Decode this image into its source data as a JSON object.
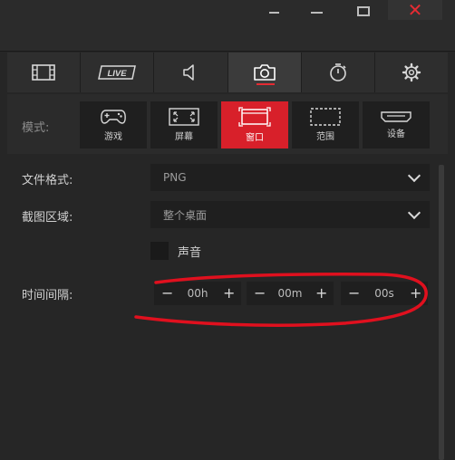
{
  "window_controls": {
    "close_glyph": "✕",
    "accent": "#e52b33"
  },
  "tabs": [
    {
      "icon": "film-icon",
      "active": false
    },
    {
      "icon": "live-icon",
      "label": "LIVE",
      "active": false
    },
    {
      "icon": "audio-icon",
      "active": false
    },
    {
      "icon": "camera-icon",
      "active": true
    },
    {
      "icon": "timer-icon",
      "active": false
    },
    {
      "icon": "gear-icon",
      "active": false
    }
  ],
  "mode": {
    "label": "模式:",
    "options": [
      {
        "icon": "gamepad-icon",
        "label": "游戏",
        "active": false
      },
      {
        "icon": "fullscreen-icon",
        "label": "屏幕",
        "active": false
      },
      {
        "icon": "window-icon",
        "label": "窗口",
        "active": true
      },
      {
        "icon": "region-icon",
        "label": "范围",
        "active": false
      },
      {
        "icon": "hdmi-icon",
        "label": "设备",
        "active": false
      }
    ]
  },
  "settings": {
    "file_format": {
      "label": "文件格式:",
      "value": "PNG"
    },
    "capture_area": {
      "label": "截图区域:",
      "value": "整个桌面"
    },
    "sound": {
      "label": "声音",
      "checked": false
    },
    "interval": {
      "label": "时间间隔:",
      "minus": "−",
      "plus": "+",
      "hours": "00h",
      "minutes": "00m",
      "seconds": "00s"
    }
  },
  "colors": {
    "accent": "#d8202a",
    "annotation": "#e0101e",
    "background": "#262626"
  }
}
